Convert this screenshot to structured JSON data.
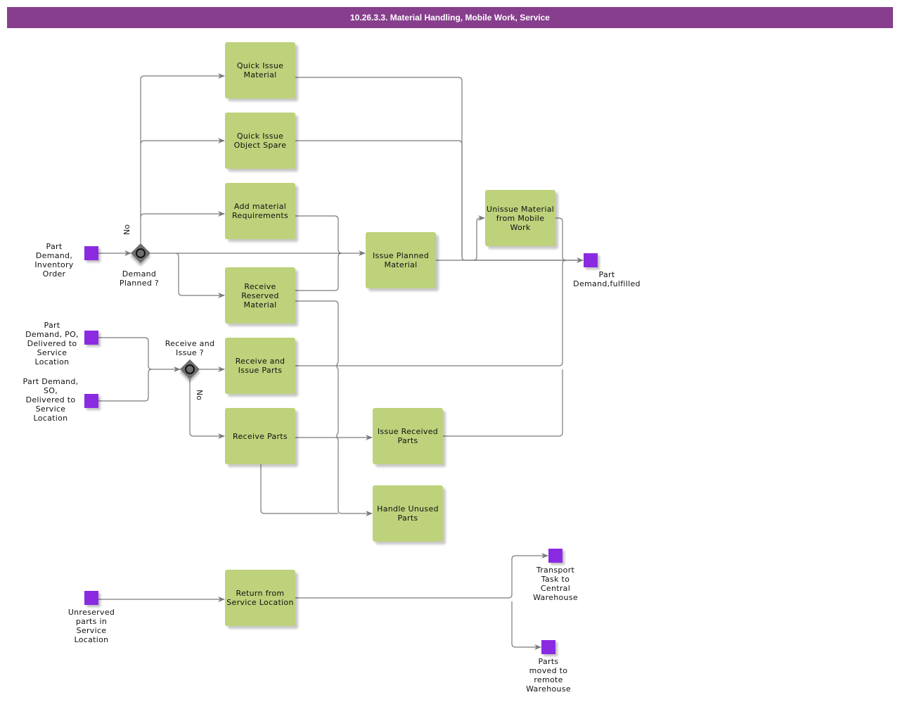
{
  "title": "10.26.3.3. Material Handling, Mobile Work, Service",
  "colors": {
    "title_bar": "#873e8d",
    "task_fill": "#bdd27b",
    "event_fill": "#8a2be2",
    "gateway_fill": "#6e6e6e",
    "connector": "#7a7a7a"
  },
  "tasks": {
    "quick_issue_material": "Quick Issue\nMaterial",
    "quick_issue_object_spare": "Quick Issue\nObject Spare",
    "add_material_requirements": "Add material\nRequirements",
    "receive_reserved_material": "Receive\nReserved\nMaterial",
    "issue_planned_material": "Issue Planned\nMaterial",
    "unissue_material": "Unissue Material\nfrom Mobile\nWork",
    "receive_and_issue_parts": "Receive and\nIssue Parts",
    "receive_parts": "Receive Parts",
    "issue_received_parts": "Issue Received\nParts",
    "handle_unused_parts": "Handle Unused\nParts",
    "return_from_service_location": "Return from\nService Location"
  },
  "events": {
    "part_demand_inventory_order": "Part\nDemand,\nInventory\nOrder",
    "part_demand_po": "Part\nDemand, PO,\nDelivered to\nService\nLocation",
    "part_demand_so": "Part Demand,\nSO,\nDelivered to\nService\nLocation",
    "part_demand_fulfilled": "Part\nDemand,fulfilled",
    "unreserved_parts": "Unreserved\nparts in\nService\nLocation",
    "transport_task": "Transport\nTask to\nCentral\nWarehouse",
    "parts_moved_remote": "Parts\nmoved to\nremote\nWarehouse"
  },
  "gateways": {
    "demand_planned": "Demand\nPlanned ?",
    "receive_and_issue": "Receive and\nIssue ?"
  },
  "flow_labels": {
    "demand_planned_no": "No",
    "receive_and_issue_no": "No"
  }
}
